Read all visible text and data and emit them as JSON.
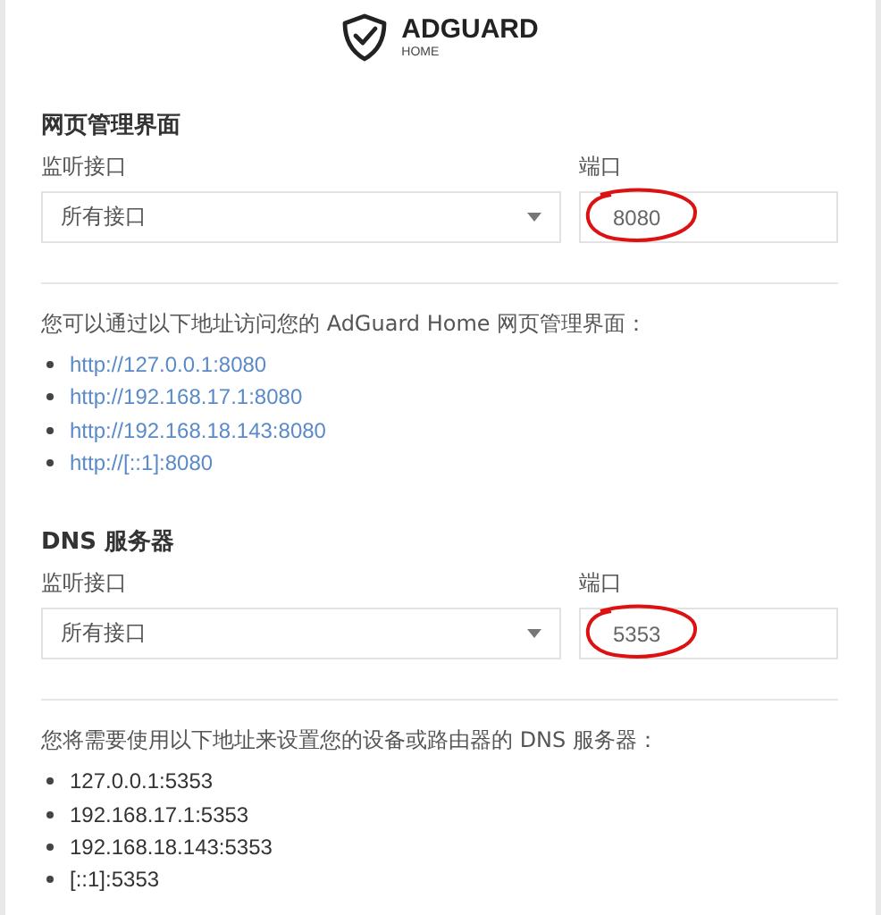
{
  "logo": {
    "title": "ADGUARD",
    "subtitle": "HOME"
  },
  "sections": [
    {
      "title": "网页管理界面",
      "interface_label": "监听接口",
      "interface_value": "所有接口",
      "port_label": "端口",
      "port_value": "8080",
      "port_circled": true,
      "description": "您可以通过以下地址访问您的 AdGuard Home 网页管理界面：",
      "addresses_linked": true,
      "addresses": [
        "http://127.0.0.1:8080",
        "http://192.168.17.1:8080",
        "http://192.168.18.143:8080",
        "http://[::1]:8080"
      ]
    },
    {
      "title": "DNS 服务器",
      "interface_label": "监听接口",
      "interface_value": "所有接口",
      "port_label": "端口",
      "port_value": "5353",
      "port_circled": true,
      "description": "您将需要使用以下地址来设置您的设备或路由器的 DNS 服务器：",
      "addresses_linked": false,
      "addresses": [
        "127.0.0.1:5353",
        "192.168.17.1:5353",
        "192.168.18.143:5353",
        "[::1]:5353"
      ]
    }
  ]
}
